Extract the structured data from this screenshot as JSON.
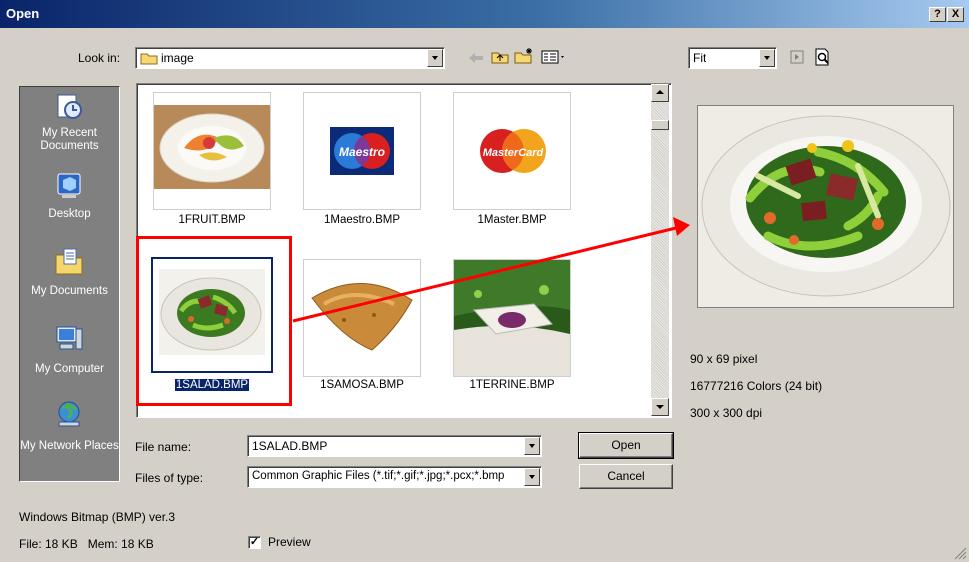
{
  "window": {
    "title": "Open",
    "help_button": "?",
    "close_button": "X"
  },
  "look_in": {
    "label": "Look in:",
    "value": "image"
  },
  "zoom": {
    "value": "Fit"
  },
  "places": [
    {
      "label": "My Recent Documents",
      "icon": "recent-documents-icon"
    },
    {
      "label": "Desktop",
      "icon": "desktop-icon"
    },
    {
      "label": "My Documents",
      "icon": "my-documents-icon"
    },
    {
      "label": "My Computer",
      "icon": "my-computer-icon"
    },
    {
      "label": "My Network Places",
      "icon": "network-places-icon"
    }
  ],
  "files": [
    {
      "name": "1FRUIT.BMP",
      "selected": false
    },
    {
      "name": "1Maestro.BMP",
      "selected": false
    },
    {
      "name": "1Master.BMP",
      "selected": false
    },
    {
      "name": "1SALAD.BMP",
      "selected": true
    },
    {
      "name": "1SAMOSA.BMP",
      "selected": false
    },
    {
      "name": "1TERRINE.BMP",
      "selected": false
    }
  ],
  "thumb_text": {
    "maestro": "Maestro",
    "mastercard": "MasterCard"
  },
  "file_name": {
    "label": "File name:",
    "value": "1SALAD.BMP"
  },
  "file_type": {
    "label": "Files of type:",
    "value": "Common Graphic Files (*.tif;*.gif;*.jpg;*.pcx;*.bmp"
  },
  "buttons": {
    "open": "Open",
    "cancel": "Cancel"
  },
  "image_info": {
    "dimensions": "90 x 69 pixel",
    "colors": "16777216 Colors (24 bit)",
    "dpi": "300 x 300 dpi"
  },
  "status": {
    "format": "Windows Bitmap (BMP) ver.3",
    "size": "File: 18 KB   Mem: 18 KB"
  },
  "preview_checkbox": {
    "label": "Preview",
    "checked": true
  },
  "colors": {
    "annotation": "#ff0000",
    "selection": "#0a246a",
    "face": "#d4d0c8"
  }
}
